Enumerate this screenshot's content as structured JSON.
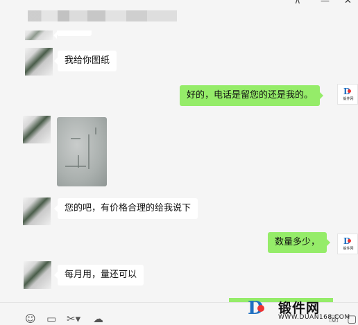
{
  "window": {
    "pin_icon": "pin-icon",
    "min_icon": "minimize-icon",
    "close_icon": "close-icon",
    "pin_glyph": "⊼",
    "min_glyph": "—",
    "close_glyph": "✕"
  },
  "messages": [
    {
      "side": "left",
      "text": "我给你图纸"
    },
    {
      "side": "right",
      "text": "好的，电话是留您的还是我的。"
    },
    {
      "side": "left",
      "type": "image"
    },
    {
      "side": "left",
      "text": "您的吧，有价格合理的给我说下"
    },
    {
      "side": "right",
      "text": "数量多少，"
    },
    {
      "side": "left",
      "text": "每月用，量还可以"
    }
  ],
  "avatar_right": {
    "logo_text": "锻件网"
  },
  "watermark": {
    "name": "锻件网",
    "url": "WWW.DUAN168.COM"
  },
  "toolbar": {
    "emoji_glyph": "☺",
    "folder_glyph": "▭",
    "cut_glyph": "✂▾",
    "chat_glyph": "☁",
    "phone_glyph": "☏",
    "video_glyph": "▢"
  },
  "colors": {
    "accent_green": "#95ec69",
    "background": "#f5f5f5",
    "brand_blue": "#1f6fc1"
  }
}
